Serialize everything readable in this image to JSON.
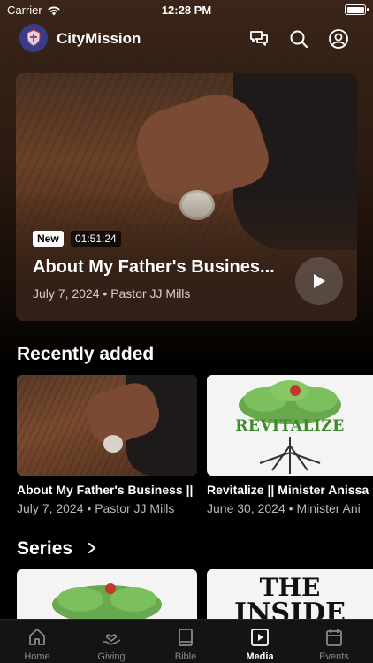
{
  "status_bar": {
    "carrier": "Carrier",
    "time": "12:28 PM"
  },
  "header": {
    "app_name": "CityMission"
  },
  "hero": {
    "badge": "New",
    "duration": "01:51:24",
    "title": "About My Father's Busines...",
    "date": "July 7, 2024",
    "author": "Pastor JJ Mills"
  },
  "recently_added": {
    "title": "Recently added",
    "items": [
      {
        "title": "About My Father's Business ||",
        "date": "July 7, 2024",
        "author": "Pastor JJ Mills"
      },
      {
        "title": "Revitalize || Minister Anissa",
        "date": "June 30, 2024",
        "author": "Minister Ani",
        "thumb_text": "REVITALIZE"
      }
    ]
  },
  "series": {
    "title": "Series",
    "items": [
      {
        "thumb_text": ""
      },
      {
        "thumb_line1": "THE",
        "thumb_line2": "INSIDE"
      }
    ]
  },
  "tabs": [
    {
      "label": "Home",
      "icon": "home-icon"
    },
    {
      "label": "Giving",
      "icon": "giving-icon"
    },
    {
      "label": "Bible",
      "icon": "bible-icon"
    },
    {
      "label": "Media",
      "icon": "media-icon",
      "active": true
    },
    {
      "label": "Events",
      "icon": "events-icon"
    }
  ],
  "colors": {
    "accent": "#ffffff",
    "brand": "#3a3c8a",
    "revitalize_green": "#3c8a2a"
  }
}
